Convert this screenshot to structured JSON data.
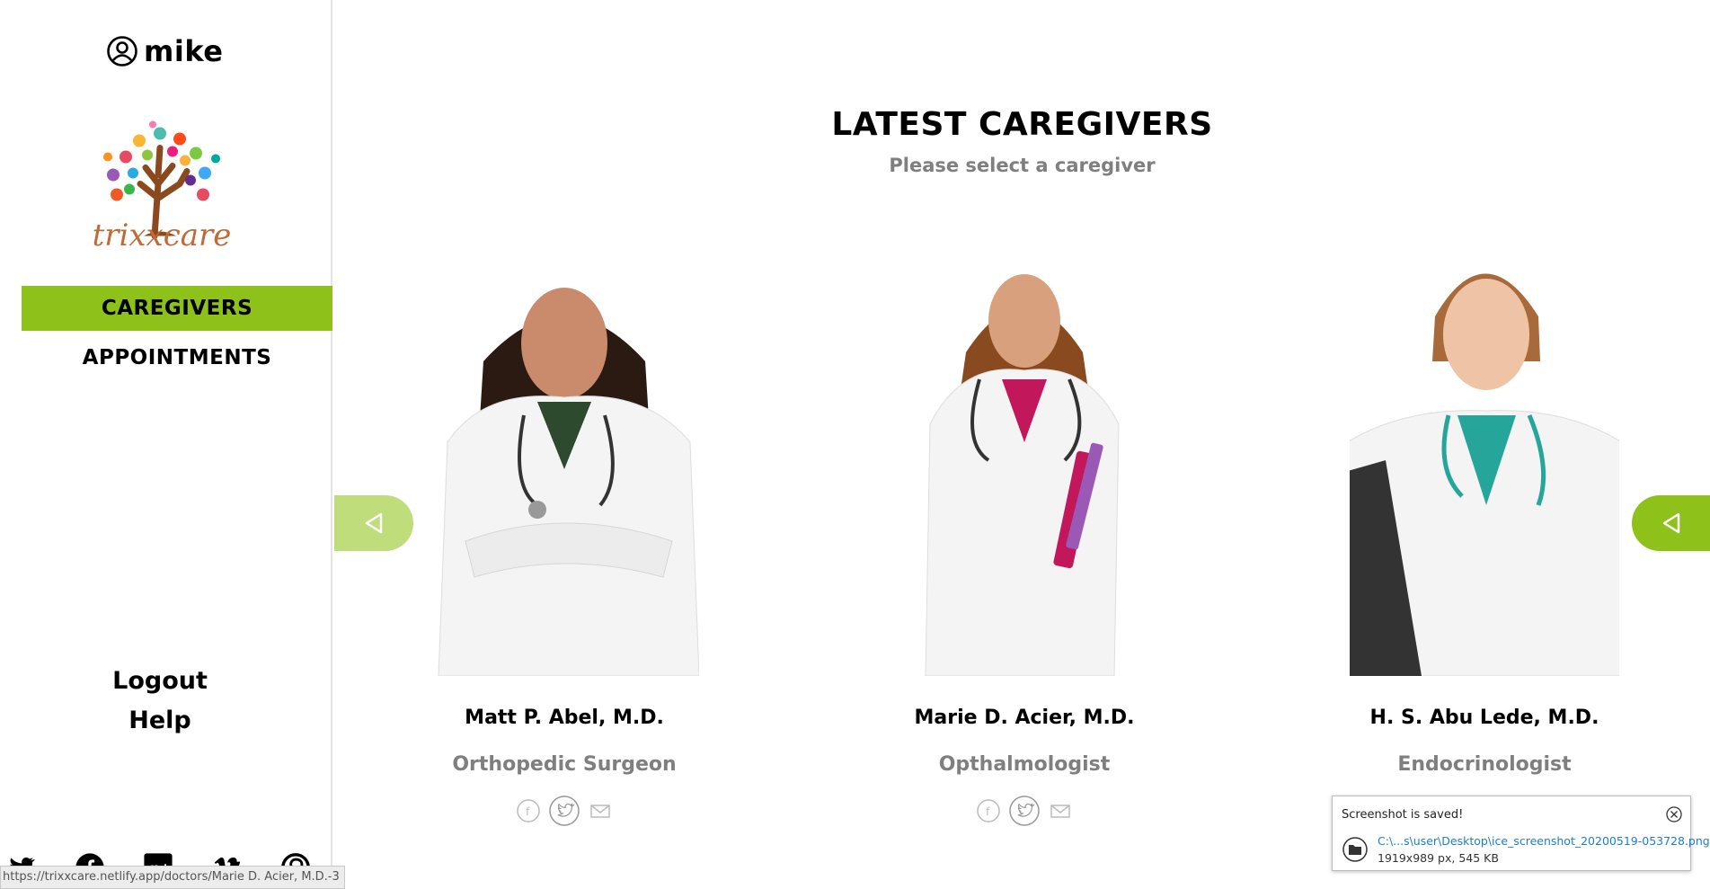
{
  "user": {
    "name": "mike"
  },
  "brand": {
    "logo_text": "trixxcare"
  },
  "nav": [
    {
      "label": "CAREGIVERS",
      "active": true
    },
    {
      "label": "APPOINTMENTS",
      "active": false
    }
  ],
  "sidebar_links": {
    "logout": "Logout",
    "help": "Help"
  },
  "socials": [
    "twitter-icon",
    "facebook-icon",
    "google-plus-icon",
    "vimeo-icon",
    "pinterest-icon"
  ],
  "status_url": "https://trixxcare.netlify.app/doctors/Marie D. Acier, M.D.-3",
  "main": {
    "heading": "LATEST CAREGIVERS",
    "subheading": "Please select a caregiver"
  },
  "caregivers": [
    {
      "name": "Matt P. Abel, M.D.",
      "specialty": "Orthopedic Surgeon"
    },
    {
      "name": "Marie D. Acier, M.D.",
      "specialty": "Opthalmologist"
    },
    {
      "name": "H. S. Abu Lede, M.D.",
      "specialty": "Endocrinologist"
    }
  ],
  "toast": {
    "title": "Screenshot is saved!",
    "path": "C:\\...s\\user\\Desktop\\ice_screenshot_20200519-053728.png",
    "info": "1919x989 px, 545 KB"
  },
  "colors": {
    "accent": "#8ec11a",
    "arrow_light": "#bfdd7a",
    "muted_text": "#7f7f7f",
    "logo_text": "#c06a35"
  }
}
